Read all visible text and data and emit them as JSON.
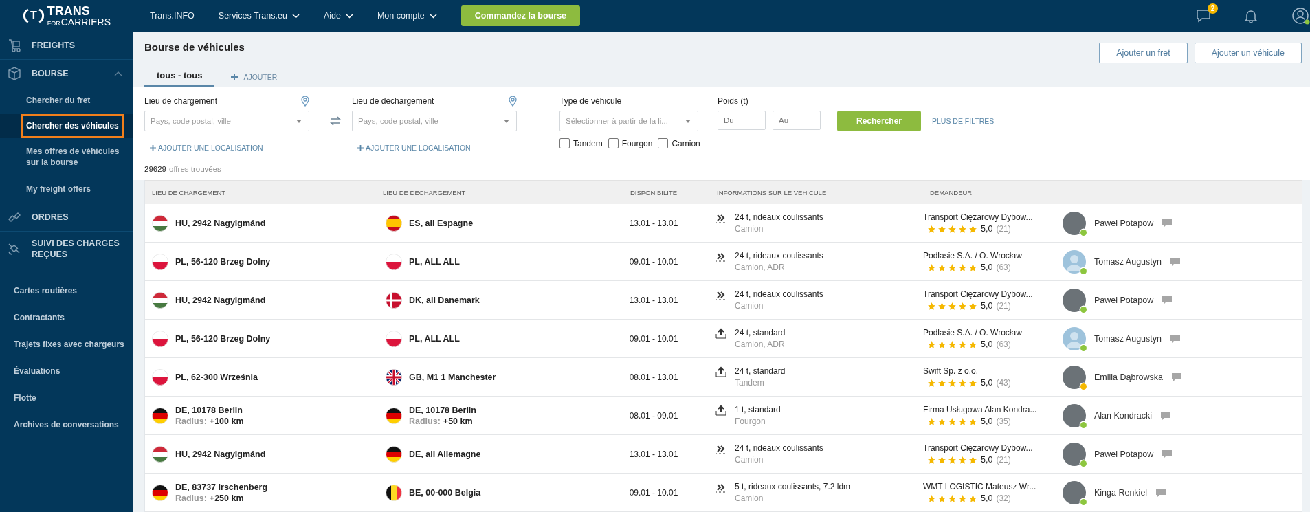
{
  "logo": {
    "mark": "T",
    "word": "TRANS",
    "sub_small": "FOR",
    "sub": "CARRIERS"
  },
  "top_nav": [
    {
      "label": "Trans.INFO",
      "dropdown": false
    },
    {
      "label": "Services Trans.eu",
      "dropdown": true
    },
    {
      "label": "Aide",
      "dropdown": true
    },
    {
      "label": "Mon compte",
      "dropdown": true
    }
  ],
  "order_button": "Commandez la bourse",
  "messages_badge": "2",
  "sidebar": {
    "sections": [
      {
        "kind": "freights",
        "label": "FREIGHTS"
      },
      {
        "kind": "bourse",
        "label": "BOURSE",
        "expanded": true,
        "children": [
          {
            "label": "Chercher du fret",
            "selected": false
          },
          {
            "label": "Chercher des véhicules",
            "selected": true
          },
          {
            "label": "Mes offres de véhicules sur la bourse",
            "selected": false
          },
          {
            "label": "My freight offers",
            "selected": false
          }
        ]
      },
      {
        "kind": "orders",
        "label": "ORDRES"
      },
      {
        "kind": "tracking",
        "label": "SUIVI DES CHARGES REÇUES"
      }
    ],
    "links": [
      "Cartes routières",
      "Contractants",
      "Trajets fixes avec chargeurs",
      "Évaluations",
      "Flotte",
      "Archives de conversations"
    ]
  },
  "page_title": "Bourse de véhicules",
  "header_buttons": [
    "Ajouter un fret",
    "Ajouter un véhicule"
  ],
  "tabs": [
    {
      "label": "tous - tous",
      "selected": true
    }
  ],
  "add_tab": "AJOUTER",
  "filters": {
    "loading": {
      "label": "Lieu de chargement",
      "placeholder": "Pays, code postal, ville",
      "add_location": "AJOUTER UNE LOCALISATION"
    },
    "unloading": {
      "label": "Lieu de déchargement",
      "placeholder": "Pays, code postal, ville",
      "add_location": "AJOUTER UNE LOCALISATION"
    },
    "vehicle_type": {
      "label": "Type de véhicule",
      "placeholder": "Sélectionner à partir de la li..."
    },
    "weight": {
      "label": "Poids (t)",
      "from_placeholder": "Du",
      "to_placeholder": "Au"
    },
    "checkboxes": [
      {
        "label": "Tandem",
        "checked": false
      },
      {
        "label": "Fourgon",
        "checked": false
      },
      {
        "label": "Camion",
        "checked": false
      }
    ],
    "search_button": "Rechercher",
    "more_filters": "PLUS DE FILTRES"
  },
  "results": {
    "count": "29629",
    "label": "offres trouvées"
  },
  "table": {
    "columns": [
      "LIEU DE CHARGEMENT",
      "LIEU DE DÉCHARGEMENT",
      "DISPONIBILITÉ",
      "INFORMATIONS SUR LE VÉHICULE",
      "DEMANDEUR"
    ],
    "rows": [
      {
        "loading": {
          "kind": "hu",
          "place": "HU, 2942 Nagyigmánd"
        },
        "unloading": {
          "kind": "es",
          "place": "ES, all Espagne"
        },
        "dates": "13.01 - 13.01",
        "vehicle": {
          "kind": "curtain",
          "info": "24 t, rideaux coulissants",
          "type": "Camion"
        },
        "company": "Transport Ciężarowy Dybow...",
        "stars": 5,
        "rating": "5,0",
        "reviews": "(21)",
        "person": {
          "kind": "photo",
          "color": "#8dc63f",
          "name": "Paweł Potapow"
        }
      },
      {
        "loading": {
          "kind": "pl",
          "place": "PL, 56-120 Brzeg Dolny"
        },
        "unloading": {
          "kind": "pl",
          "place": "PL, ALL ALL"
        },
        "dates": "09.01 - 10.01",
        "vehicle": {
          "kind": "curtain",
          "info": "24 t, rideaux coulissants",
          "type": "Camion, ADR"
        },
        "company": "Podlasie S.A. / O. Wrocław",
        "stars": 5,
        "rating": "5,0",
        "reviews": "(63)",
        "person": {
          "kind": "silhouette",
          "color": "#8dc63f",
          "name": "Tomasz Augustyn"
        }
      },
      {
        "loading": {
          "kind": "hu",
          "place": "HU, 2942 Nagyigmánd"
        },
        "unloading": {
          "kind": "dk",
          "place": "DK, all Danemark"
        },
        "dates": "13.01 - 13.01",
        "vehicle": {
          "kind": "curtain",
          "info": "24 t, rideaux coulissants",
          "type": "Camion"
        },
        "company": "Transport Ciężarowy Dybow...",
        "stars": 5,
        "rating": "5,0",
        "reviews": "(21)",
        "person": {
          "kind": "photo",
          "color": "#8dc63f",
          "name": "Paweł Potapow"
        }
      },
      {
        "loading": {
          "kind": "pl",
          "place": "PL, 56-120 Brzeg Dolny"
        },
        "unloading": {
          "kind": "pl",
          "place": "PL, ALL ALL"
        },
        "dates": "09.01 - 10.01",
        "vehicle": {
          "kind": "standard",
          "info": "24 t, standard",
          "type": "Camion, ADR"
        },
        "company": "Podlasie S.A. / O. Wrocław",
        "stars": 5,
        "rating": "5,0",
        "reviews": "(63)",
        "person": {
          "kind": "silhouette",
          "color": "#8dc63f",
          "name": "Tomasz Augustyn"
        }
      },
      {
        "loading": {
          "kind": "pl",
          "place": "PL, 62-300 Września"
        },
        "unloading": {
          "kind": "gb",
          "place": "GB, M1 1 Manchester"
        },
        "dates": "08.01 - 13.01",
        "vehicle": {
          "kind": "standard",
          "info": "24 t, standard",
          "type": "Tandem"
        },
        "company": "Swift Sp. z o.o.",
        "stars": 5,
        "rating": "5,0",
        "reviews": "(43)",
        "person": {
          "kind": "photo",
          "color": "#f5b800",
          "name": "Emilia Dąbrowska"
        }
      },
      {
        "loading": {
          "kind": "de",
          "place": "DE, 10178 Berlin",
          "radius_label": "Radius:",
          "radius": "+100 km"
        },
        "unloading": {
          "kind": "de",
          "place": "DE, 10178 Berlin",
          "radius_label": "Radius:",
          "radius": "+50 km"
        },
        "dates": "08.01 - 09.01",
        "vehicle": {
          "kind": "standard",
          "info": "1 t, standard",
          "type": "Fourgon"
        },
        "company": "Firma Usługowa Alan Kondra...",
        "stars": 5,
        "rating": "5,0",
        "reviews": "(35)",
        "person": {
          "kind": "photo",
          "color": "#8dc63f",
          "name": "Alan Kondracki"
        }
      },
      {
        "loading": {
          "kind": "hu",
          "place": "HU, 2942 Nagyigmánd"
        },
        "unloading": {
          "kind": "de",
          "place": "DE, all Allemagne"
        },
        "dates": "13.01 - 13.01",
        "vehicle": {
          "kind": "curtain",
          "info": "24 t, rideaux coulissants",
          "type": "Camion"
        },
        "company": "Transport Ciężarowy Dybow...",
        "stars": 5,
        "rating": "5,0",
        "reviews": "(21)",
        "person": {
          "kind": "photo",
          "color": "#8dc63f",
          "name": "Paweł Potapow"
        }
      },
      {
        "loading": {
          "kind": "de",
          "place": "DE, 83737 Irschenberg",
          "radius_label": "Radius:",
          "radius": "+250 km"
        },
        "unloading": {
          "kind": "be",
          "place": "BE, 00-000 Belgia"
        },
        "dates": "09.01 - 10.01",
        "vehicle": {
          "kind": "curtain",
          "info": "5 t, rideaux coulissants, 7.2 ldm",
          "type": "Camion"
        },
        "company": "WMT LOGISTIC Mateusz Wr...",
        "stars": 5,
        "rating": "5,0",
        "reviews": "(32)",
        "person": {
          "kind": "photo",
          "color": "#8dc63f",
          "name": "Kinga Renkiel"
        }
      }
    ]
  }
}
